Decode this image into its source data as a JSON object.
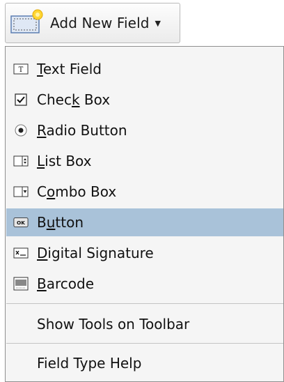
{
  "toolbar": {
    "add_field_label": "Add New Field",
    "caret": "▼"
  },
  "menu": {
    "items": [
      {
        "pre": "",
        "key": "T",
        "post": "ext Field",
        "icon": "text-field-icon",
        "selected": false
      },
      {
        "pre": "Chec",
        "key": "k",
        "post": " Box",
        "icon": "check-box-icon",
        "selected": false
      },
      {
        "pre": "",
        "key": "R",
        "post": "adio Button",
        "icon": "radio-button-icon",
        "selected": false
      },
      {
        "pre": "",
        "key": "L",
        "post": "ist Box",
        "icon": "list-box-icon",
        "selected": false
      },
      {
        "pre": "C",
        "key": "o",
        "post": "mbo Box",
        "icon": "combo-box-icon",
        "selected": false
      },
      {
        "pre": "B",
        "key": "u",
        "post": "tton",
        "icon": "button-icon",
        "selected": true
      },
      {
        "pre": "",
        "key": "D",
        "post": "igital Signature",
        "icon": "digital-signature-icon",
        "selected": false
      },
      {
        "pre": "",
        "key": "B",
        "post": "arcode",
        "icon": "barcode-icon",
        "selected": false
      }
    ],
    "show_tools": "Show Tools on Toolbar",
    "help": "Field Type Help"
  },
  "colors": {
    "selected_bg": "#a9c2d9",
    "menu_bg": "#f5f5f5",
    "border": "#8f8f8f"
  }
}
